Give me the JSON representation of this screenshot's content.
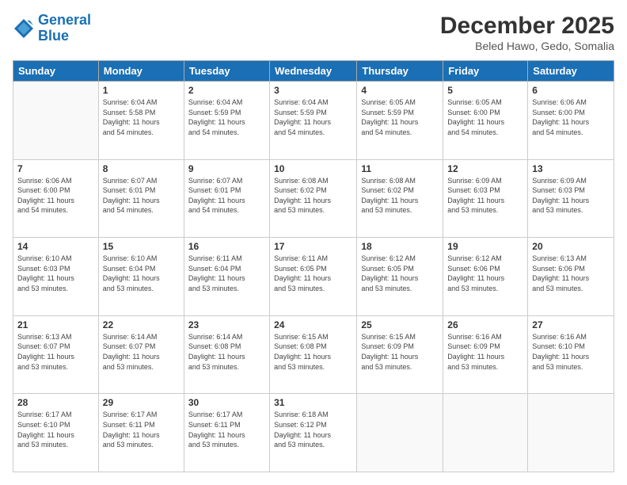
{
  "logo": {
    "line1": "General",
    "line2": "Blue"
  },
  "title": "December 2025",
  "subtitle": "Beled Hawo, Gedo, Somalia",
  "days_header": [
    "Sunday",
    "Monday",
    "Tuesday",
    "Wednesday",
    "Thursday",
    "Friday",
    "Saturday"
  ],
  "weeks": [
    [
      {
        "day": "",
        "info": ""
      },
      {
        "day": "1",
        "info": "Sunrise: 6:04 AM\nSunset: 5:58 PM\nDaylight: 11 hours\nand 54 minutes."
      },
      {
        "day": "2",
        "info": "Sunrise: 6:04 AM\nSunset: 5:59 PM\nDaylight: 11 hours\nand 54 minutes."
      },
      {
        "day": "3",
        "info": "Sunrise: 6:04 AM\nSunset: 5:59 PM\nDaylight: 11 hours\nand 54 minutes."
      },
      {
        "day": "4",
        "info": "Sunrise: 6:05 AM\nSunset: 5:59 PM\nDaylight: 11 hours\nand 54 minutes."
      },
      {
        "day": "5",
        "info": "Sunrise: 6:05 AM\nSunset: 6:00 PM\nDaylight: 11 hours\nand 54 minutes."
      },
      {
        "day": "6",
        "info": "Sunrise: 6:06 AM\nSunset: 6:00 PM\nDaylight: 11 hours\nand 54 minutes."
      }
    ],
    [
      {
        "day": "7",
        "info": "Sunrise: 6:06 AM\nSunset: 6:00 PM\nDaylight: 11 hours\nand 54 minutes."
      },
      {
        "day": "8",
        "info": "Sunrise: 6:07 AM\nSunset: 6:01 PM\nDaylight: 11 hours\nand 54 minutes."
      },
      {
        "day": "9",
        "info": "Sunrise: 6:07 AM\nSunset: 6:01 PM\nDaylight: 11 hours\nand 54 minutes."
      },
      {
        "day": "10",
        "info": "Sunrise: 6:08 AM\nSunset: 6:02 PM\nDaylight: 11 hours\nand 53 minutes."
      },
      {
        "day": "11",
        "info": "Sunrise: 6:08 AM\nSunset: 6:02 PM\nDaylight: 11 hours\nand 53 minutes."
      },
      {
        "day": "12",
        "info": "Sunrise: 6:09 AM\nSunset: 6:03 PM\nDaylight: 11 hours\nand 53 minutes."
      },
      {
        "day": "13",
        "info": "Sunrise: 6:09 AM\nSunset: 6:03 PM\nDaylight: 11 hours\nand 53 minutes."
      }
    ],
    [
      {
        "day": "14",
        "info": "Sunrise: 6:10 AM\nSunset: 6:03 PM\nDaylight: 11 hours\nand 53 minutes."
      },
      {
        "day": "15",
        "info": "Sunrise: 6:10 AM\nSunset: 6:04 PM\nDaylight: 11 hours\nand 53 minutes."
      },
      {
        "day": "16",
        "info": "Sunrise: 6:11 AM\nSunset: 6:04 PM\nDaylight: 11 hours\nand 53 minutes."
      },
      {
        "day": "17",
        "info": "Sunrise: 6:11 AM\nSunset: 6:05 PM\nDaylight: 11 hours\nand 53 minutes."
      },
      {
        "day": "18",
        "info": "Sunrise: 6:12 AM\nSunset: 6:05 PM\nDaylight: 11 hours\nand 53 minutes."
      },
      {
        "day": "19",
        "info": "Sunrise: 6:12 AM\nSunset: 6:06 PM\nDaylight: 11 hours\nand 53 minutes."
      },
      {
        "day": "20",
        "info": "Sunrise: 6:13 AM\nSunset: 6:06 PM\nDaylight: 11 hours\nand 53 minutes."
      }
    ],
    [
      {
        "day": "21",
        "info": "Sunrise: 6:13 AM\nSunset: 6:07 PM\nDaylight: 11 hours\nand 53 minutes."
      },
      {
        "day": "22",
        "info": "Sunrise: 6:14 AM\nSunset: 6:07 PM\nDaylight: 11 hours\nand 53 minutes."
      },
      {
        "day": "23",
        "info": "Sunrise: 6:14 AM\nSunset: 6:08 PM\nDaylight: 11 hours\nand 53 minutes."
      },
      {
        "day": "24",
        "info": "Sunrise: 6:15 AM\nSunset: 6:08 PM\nDaylight: 11 hours\nand 53 minutes."
      },
      {
        "day": "25",
        "info": "Sunrise: 6:15 AM\nSunset: 6:09 PM\nDaylight: 11 hours\nand 53 minutes."
      },
      {
        "day": "26",
        "info": "Sunrise: 6:16 AM\nSunset: 6:09 PM\nDaylight: 11 hours\nand 53 minutes."
      },
      {
        "day": "27",
        "info": "Sunrise: 6:16 AM\nSunset: 6:10 PM\nDaylight: 11 hours\nand 53 minutes."
      }
    ],
    [
      {
        "day": "28",
        "info": "Sunrise: 6:17 AM\nSunset: 6:10 PM\nDaylight: 11 hours\nand 53 minutes."
      },
      {
        "day": "29",
        "info": "Sunrise: 6:17 AM\nSunset: 6:11 PM\nDaylight: 11 hours\nand 53 minutes."
      },
      {
        "day": "30",
        "info": "Sunrise: 6:17 AM\nSunset: 6:11 PM\nDaylight: 11 hours\nand 53 minutes."
      },
      {
        "day": "31",
        "info": "Sunrise: 6:18 AM\nSunset: 6:12 PM\nDaylight: 11 hours\nand 53 minutes."
      },
      {
        "day": "",
        "info": ""
      },
      {
        "day": "",
        "info": ""
      },
      {
        "day": "",
        "info": ""
      }
    ]
  ]
}
